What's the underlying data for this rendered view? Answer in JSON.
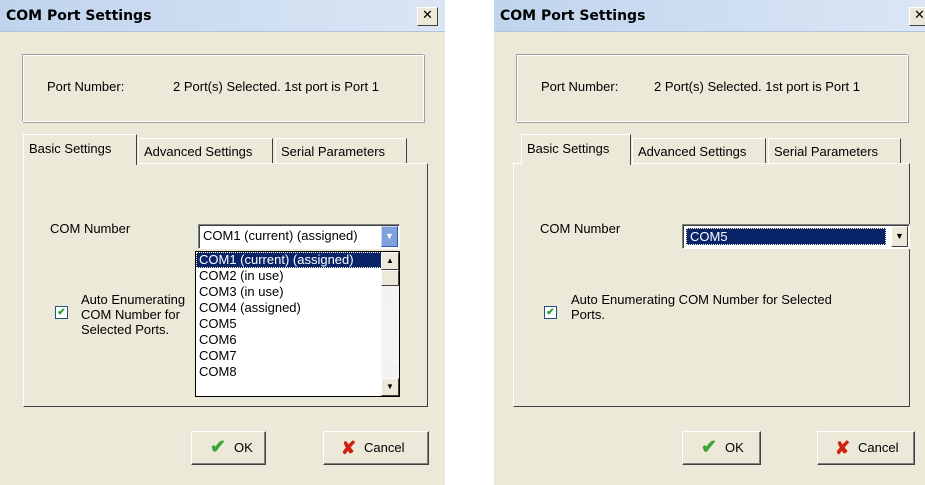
{
  "dialogs": [
    {
      "title": "COM Port Settings",
      "close_glyph": "✕",
      "port_label": "Port Number:",
      "port_value": "2 Port(s) Selected. 1st port is Port 1",
      "tabs": [
        "Basic Settings",
        "Advanced Settings",
        "Serial Parameters"
      ],
      "active_tab": "Basic Settings",
      "com_label": "COM Number",
      "com_value": "COM1 (current) (assigned)",
      "checkbox_checked": true,
      "checkbox_label": "Auto Enumerating COM Number for Selected Ports.",
      "dropdown_open": true,
      "dropdown_options": [
        "COM1 (current) (assigned)",
        "COM2 (in use)",
        "COM3 (in use)",
        "COM4 (assigned)",
        "COM5",
        "COM6",
        "COM7",
        "COM8"
      ],
      "ok_label": "OK",
      "cancel_label": "Cancel"
    },
    {
      "title": "COM Port Settings",
      "close_glyph": "✕",
      "port_label": "Port Number:",
      "port_value": "2 Port(s) Selected. 1st port is Port 1",
      "tabs": [
        "Basic Settings",
        "Advanced Settings",
        "Serial Parameters"
      ],
      "active_tab": "Basic Settings",
      "com_label": "COM Number",
      "com_value": "COM5",
      "checkbox_checked": true,
      "checkbox_label": "Auto Enumerating COM Number for Selected Ports.",
      "dropdown_open": false,
      "ok_label": "OK",
      "cancel_label": "Cancel"
    }
  ],
  "icons": {
    "ok": "green-checkmark-icon",
    "cancel": "red-x-icon",
    "check": "checkmark",
    "dropdown": "chevron-down-icon"
  },
  "colors": {
    "dialog_bg": "#ece9d8",
    "selection_bg": "#0a246a",
    "ok_green": "#3aa63a",
    "cancel_red": "#d02010"
  }
}
